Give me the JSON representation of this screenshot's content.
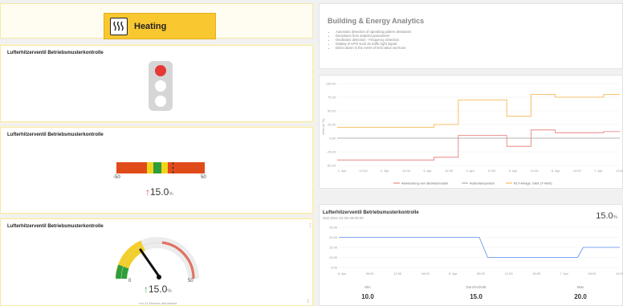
{
  "header": {
    "heating_label": "Heating"
  },
  "traffic_card": {
    "title": "Lufterhitzerventil Betriebsmusterkontrolle"
  },
  "scale_card": {
    "title": "Lufterhitzerventil Betriebsmusterkontrolle",
    "min_label": "-50",
    "max_label": "50",
    "value_arrow": "↑",
    "value": "15.0",
    "unit": "%"
  },
  "gauge_card": {
    "title": "Lufterhitzerventil Betriebsmusterkontrolle",
    "min_label": "0",
    "max_label": "50",
    "value_arrow": "↑",
    "value": "15.0",
    "unit": "%",
    "footer": "Vor 24 Minuten aktualisiert",
    "menu": "⋮",
    "scroll_marker": "↕"
  },
  "analytics": {
    "title": "Building & Energy Analytics",
    "items": [
      "Automatic detection of operating pattern deviations",
      "Deviations from setpoint parameters",
      "Oscillation detection - Frequency detection",
      "Display in KPIs such as traffic light signal",
      "Direct alarm in the event of limit value overruns"
    ]
  },
  "chart_main": {
    "ylabel": "Wert (in %)",
    "ytick_labels": [
      "100.00",
      "75.00",
      "50.00",
      "25.00",
      "0.00",
      "-25.00",
      "-50.00"
    ],
    "xtick_labels": [
      "1. Apr",
      "12:00",
      "2. Apr",
      "12:00",
      "3. Apr",
      "12:00",
      "4. Apr",
      "12:00",
      "5. Apr",
      "12:00",
      "6. Apr",
      "12:00",
      "7. Apr",
      "12:00"
    ],
    "legend": [
      "Abweichung vom Betriebsmuster",
      "Außentemperatur",
      "RLT-Anlage: Stell. (T-Wert)"
    ]
  },
  "chart_bottom": {
    "title": "Lufterhitzerventil Betriebsmusterkontrolle",
    "subtitle": "Seit 2021-04-05 09:00:00",
    "current_value": "15.0",
    "unit": "%",
    "ytick_labels": [
      "25.00",
      "20.00",
      "15.00",
      "10.00",
      "5.00"
    ],
    "xtick_labels": [
      "6. Apr",
      "06:00",
      "12:00",
      "18:00",
      "6. Apr",
      "06:00",
      "12:00",
      "18:00",
      "7. Apr",
      "06:00",
      "12:00"
    ],
    "stats": [
      {
        "label": "Min",
        "value": "10.0"
      },
      {
        "label": "Durchschnitt",
        "value": "15.0"
      },
      {
        "label": "Max",
        "value": "20.0"
      }
    ]
  },
  "chart_data": [
    {
      "type": "line",
      "ylabel": "Wert (in %)",
      "ylim": [
        -50,
        100
      ],
      "x": [
        0,
        1.2,
        2.4,
        3.0,
        3.6,
        4.2,
        4.8,
        5.4,
        6.0,
        6.6,
        7.0
      ],
      "series": [
        {
          "name": "Abweichung vom Betriebsmuster",
          "color": "#e57373",
          "values": [
            -40,
            -40,
            -35,
            5,
            5,
            -15,
            15,
            10,
            10,
            12,
            12
          ]
        },
        {
          "name": "Außentemperatur",
          "color": "#9e9e9e",
          "values": [
            0,
            0,
            0,
            0,
            0,
            0,
            0,
            0,
            0,
            0,
            0
          ]
        },
        {
          "name": "RLT-Anlage: Stell. (T-Wert)",
          "color": "#f5b041",
          "values": [
            20,
            20,
            25,
            70,
            70,
            40,
            80,
            75,
            75,
            80,
            80
          ]
        }
      ],
      "grid": true,
      "legend": "bottom"
    },
    {
      "type": "line",
      "title": "Lufterhitzerventil Betriebsmusterkontrolle",
      "ylim": [
        5,
        25
      ],
      "x": [
        0,
        0.5,
        0.53,
        0.85,
        0.87,
        1.0
      ],
      "series": [
        {
          "name": "Lufterhitzerventil",
          "color": "#5b8def",
          "values": [
            20,
            20,
            10,
            10,
            15,
            15
          ]
        }
      ],
      "grid": true
    }
  ]
}
